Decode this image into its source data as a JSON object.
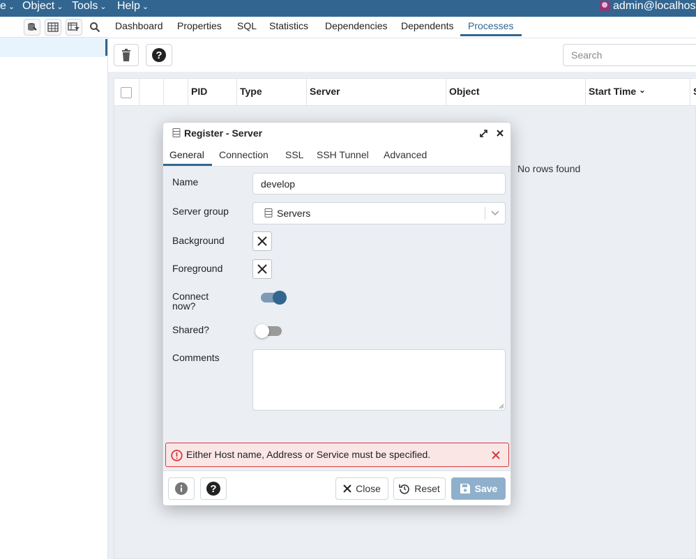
{
  "menubar": {
    "items": [
      {
        "label": "e"
      },
      {
        "label": "Object"
      },
      {
        "label": "Tools"
      },
      {
        "label": "Help"
      }
    ],
    "user": "admin@localhost"
  },
  "tabs": [
    "Dashboard",
    "Properties",
    "SQL",
    "Statistics",
    "Dependencies",
    "Dependents",
    "Processes"
  ],
  "search": {
    "placeholder": "Search"
  },
  "grid": {
    "columns": [
      "PID",
      "Type",
      "Server",
      "Object",
      "Start Time",
      "S"
    ],
    "empty_text": "No rows found"
  },
  "dialog": {
    "title": "Register - Server",
    "tabs": [
      "General",
      "Connection",
      "SSL",
      "SSH Tunnel",
      "Advanced"
    ],
    "fields": {
      "name_label": "Name",
      "name_value": "develop",
      "group_label": "Server group",
      "group_value": "Servers",
      "background_label": "Background",
      "foreground_label": "Foreground",
      "connect_label_1": "Connect",
      "connect_label_2": "now?",
      "connect_on": true,
      "shared_label": "Shared?",
      "shared_on": false,
      "comments_label": "Comments"
    },
    "error": "Either Host name, Address or Service must be specified.",
    "buttons": {
      "close": "Close",
      "reset": "Reset",
      "save": "Save"
    }
  },
  "colors": {
    "brand": "#326690",
    "error": "#d33b3b"
  }
}
